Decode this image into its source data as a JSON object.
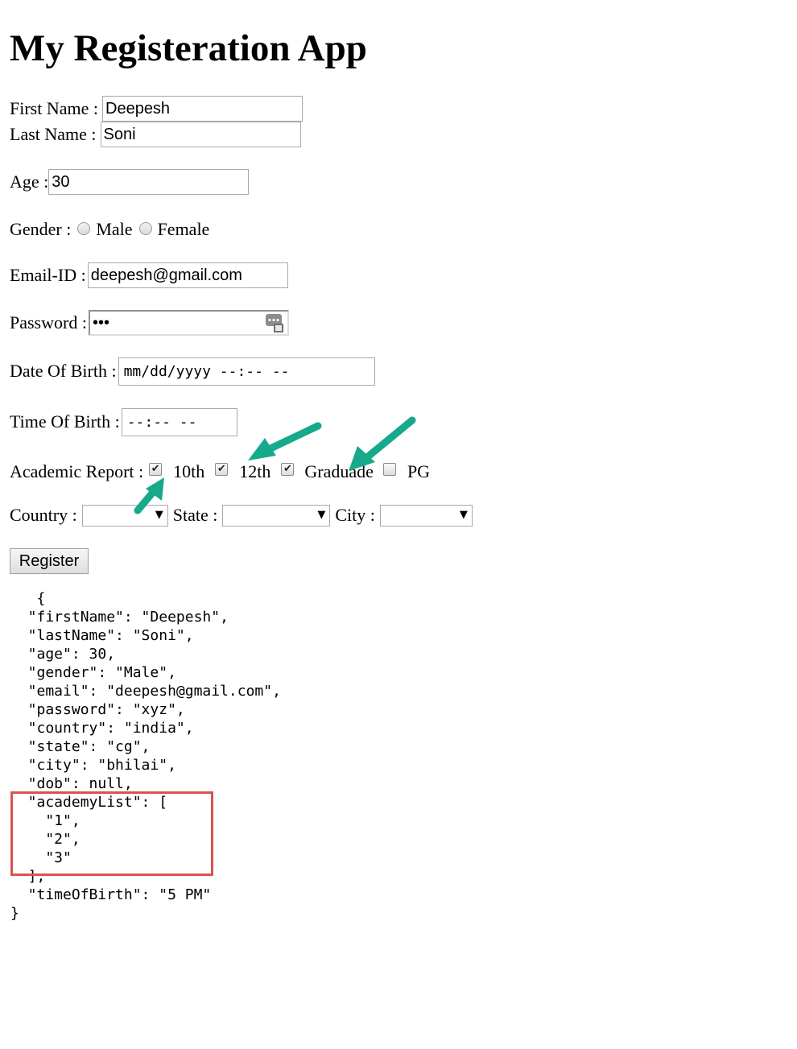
{
  "page": {
    "title": "My Registeration App"
  },
  "form": {
    "first_name": {
      "label": "First Name :",
      "value": "Deepesh"
    },
    "last_name": {
      "label": "Last Name :",
      "value": "Soni"
    },
    "age": {
      "label": "Age :",
      "value": "30"
    },
    "gender": {
      "label": "Gender :",
      "options": [
        "Male",
        "Female"
      ]
    },
    "email": {
      "label": "Email-ID :",
      "value": "deepesh@gmail.com"
    },
    "password": {
      "label": "Password :",
      "value": "•••"
    },
    "dob": {
      "label": "Date Of Birth :",
      "value": "mm/dd/yyyy --:-- --"
    },
    "tob": {
      "label": "Time Of Birth :",
      "value": "--:-- --"
    },
    "academic": {
      "label": "Academic Report :",
      "items": [
        {
          "label": "10th",
          "checked": true
        },
        {
          "label": "12th",
          "checked": true
        },
        {
          "label": "Graduade",
          "checked": true
        },
        {
          "label": "PG",
          "checked": false
        }
      ]
    },
    "country": {
      "label": "Country :"
    },
    "state": {
      "label": "State :"
    },
    "city": {
      "label": "City :"
    },
    "register_label": "Register"
  },
  "json_output": "   {\n  \"firstName\": \"Deepesh\",\n  \"lastName\": \"Soni\",\n  \"age\": 30,\n  \"gender\": \"Male\",\n  \"email\": \"deepesh@gmail.com\",\n  \"password\": \"xyz\",\n  \"country\": \"india\",\n  \"state\": \"cg\",\n  \"city\": \"bhilai\",\n  \"dob\": null,\n  \"academyList\": [\n    \"1\",\n    \"2\",\n    \"3\"\n  ],\n  \"timeOfBirth\": \"5 PM\"\n}",
  "colors": {
    "arrow": "#16a98b",
    "highlight": "#d9534f"
  }
}
